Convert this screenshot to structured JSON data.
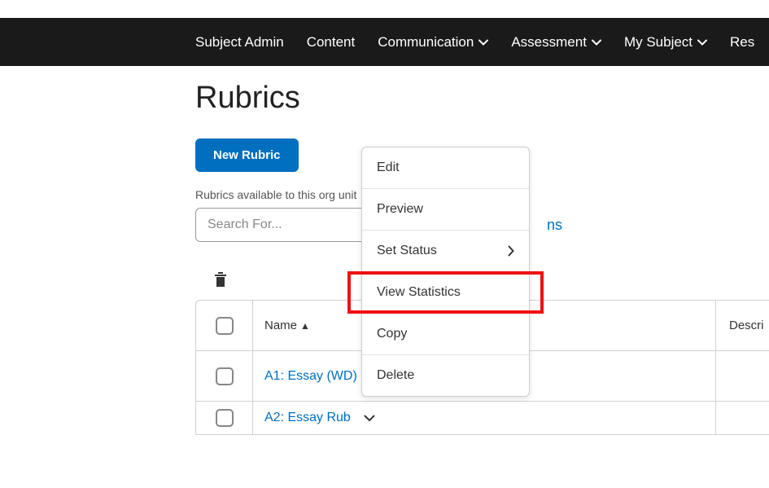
{
  "nav": {
    "items": [
      {
        "label": "Subject Admin",
        "hasChevron": false
      },
      {
        "label": "Content",
        "hasChevron": false
      },
      {
        "label": "Communication",
        "hasChevron": true
      },
      {
        "label": "Assessment",
        "hasChevron": true
      },
      {
        "label": "My Subject",
        "hasChevron": true
      },
      {
        "label": "Res",
        "hasChevron": false
      }
    ]
  },
  "page": {
    "title": "Rubrics",
    "newButton": "New Rubric",
    "subtext": "Rubrics available to this org unit",
    "searchPlaceholder": "Search For...",
    "linkFragment": "ns"
  },
  "table": {
    "columns": {
      "name": "Name",
      "description": "Descri"
    },
    "rows": [
      {
        "name": "A1: Essay (WD)"
      },
      {
        "name": "A2: Essay Rub"
      }
    ]
  },
  "dropdown": {
    "items": [
      {
        "label": "Edit",
        "submenu": false
      },
      {
        "label": "Preview",
        "submenu": false
      },
      {
        "label": "Set Status",
        "submenu": true
      },
      {
        "label": "View Statistics",
        "submenu": false
      },
      {
        "label": "Copy",
        "submenu": false
      },
      {
        "label": "Delete",
        "submenu": false
      }
    ]
  }
}
